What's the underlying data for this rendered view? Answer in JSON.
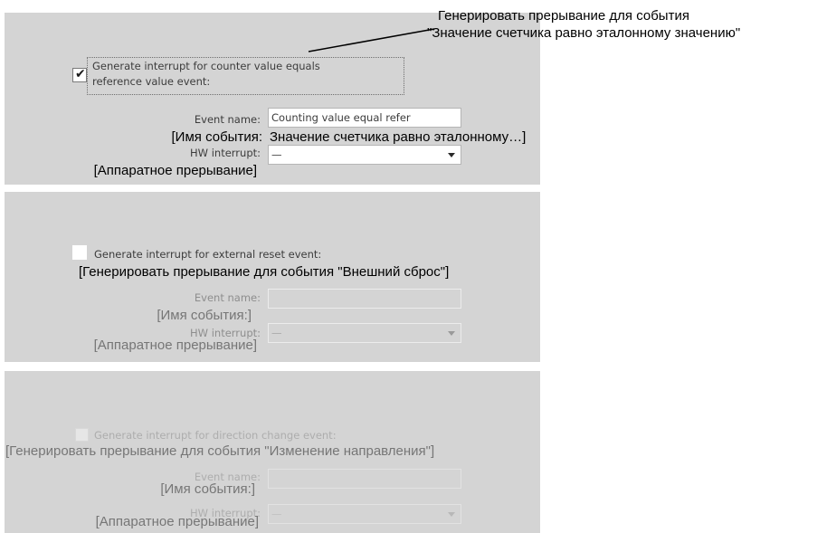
{
  "callout": {
    "line1": "Генерировать прерывание для события",
    "line2": "\"Значение счетчика равно эталонному значению\""
  },
  "sections": [
    {
      "checkbox_label_line1": "Generate interrupt for counter value equals",
      "checkbox_label_line2": "reference value event:",
      "checked": true,
      "event_name_label": "Event name:",
      "event_name_value": "Counting value equal refer",
      "event_name_ru": "[Имя события:",
      "event_name_value_ru": "Значение счетчика равно эталонному…]",
      "hw_label": "HW interrupt:",
      "hw_value": "—",
      "hw_ru": "[Аппаратное прерывание]"
    },
    {
      "checkbox_label": "Generate interrupt for external reset event:",
      "checkbox_label_ru": "[Генерировать прерывание для события \"Внешний сброс\"]",
      "checked": false,
      "event_name_label": "Event name:",
      "event_name_ru": "[Имя события:]",
      "hw_label": "HW interrupt:",
      "hw_value": "—",
      "hw_ru": "[Аппаратное прерывание]"
    },
    {
      "checkbox_label": "Generate interrupt for direction change event:",
      "checkbox_label_ru": "[Генерировать прерывание для события \"Изменение направления\"]",
      "checked": false,
      "event_name_label": "Event name:",
      "event_name_ru": "[Имя события:]",
      "hw_label": "HW interrupt:",
      "hw_value": "—",
      "hw_ru": "[Аппаратное прерывание]"
    }
  ]
}
